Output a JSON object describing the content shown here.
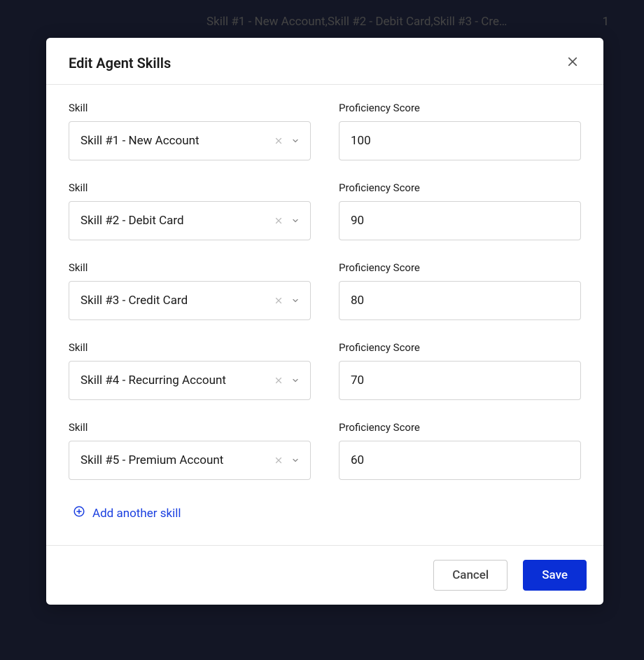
{
  "backdrop": {
    "summary": "Skill #1 - New Account,Skill #2 - Debit Card,Skill #3 - Cre…",
    "count": "1"
  },
  "modal": {
    "title": "Edit Agent Skills",
    "skill_label": "Skill",
    "score_label": "Proficiency Score",
    "rows": [
      {
        "skill": "Skill #1 - New Account",
        "score": "100"
      },
      {
        "skill": "Skill #2 - Debit Card",
        "score": "90"
      },
      {
        "skill": "Skill #3 - Credit Card",
        "score": "80"
      },
      {
        "skill": "Skill #4 - Recurring Account",
        "score": "70"
      },
      {
        "skill": "Skill #5 - Premium Account",
        "score": "60"
      }
    ],
    "add_label": "Add another skill",
    "cancel_label": "Cancel",
    "save_label": "Save"
  }
}
